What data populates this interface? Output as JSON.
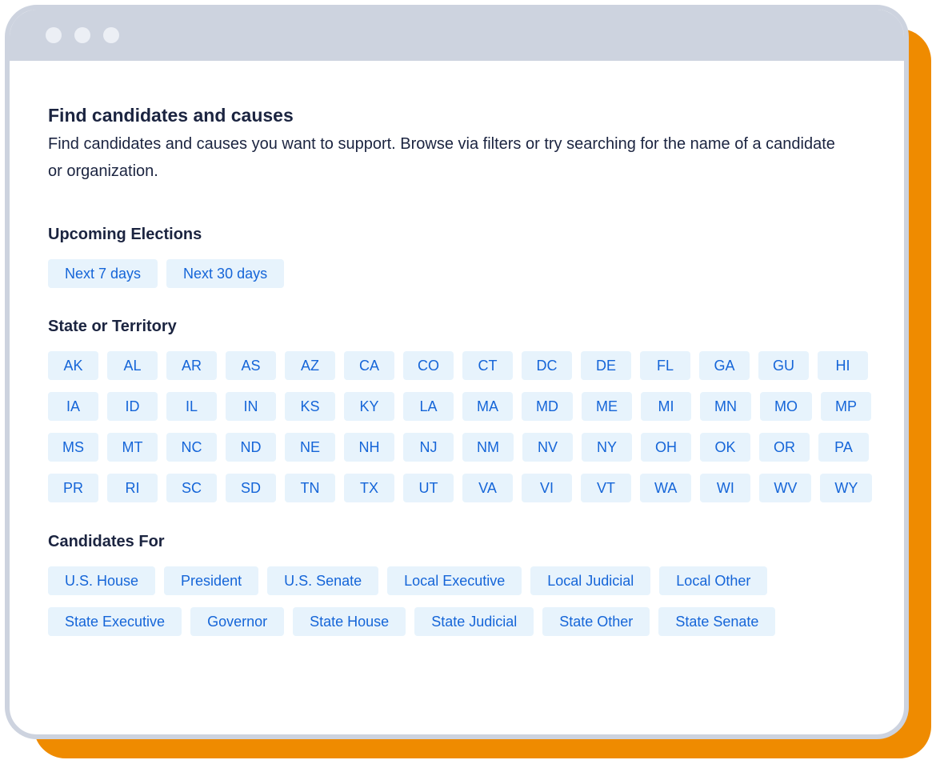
{
  "header": {
    "title": "Find candidates and causes",
    "description": "Find candidates and causes you want to support. Browse via filters or try searching for the name of a candidate or organization."
  },
  "upcoming_elections": {
    "title": "Upcoming Elections",
    "options": [
      "Next 7 days",
      "Next 30 days"
    ]
  },
  "states": {
    "title": "State or Territory",
    "options": [
      "AK",
      "AL",
      "AR",
      "AS",
      "AZ",
      "CA",
      "CO",
      "CT",
      "DC",
      "DE",
      "FL",
      "GA",
      "GU",
      "HI",
      "IA",
      "ID",
      "IL",
      "IN",
      "KS",
      "KY",
      "LA",
      "MA",
      "MD",
      "ME",
      "MI",
      "MN",
      "MO",
      "MP",
      "MS",
      "MT",
      "NC",
      "ND",
      "NE",
      "NH",
      "NJ",
      "NM",
      "NV",
      "NY",
      "OH",
      "OK",
      "OR",
      "PA",
      "PR",
      "RI",
      "SC",
      "SD",
      "TN",
      "TX",
      "UT",
      "VA",
      "VI",
      "VT",
      "WA",
      "WI",
      "WV",
      "WY"
    ]
  },
  "candidates_for": {
    "title": "Candidates For",
    "options": [
      "U.S. House",
      "President",
      "U.S. Senate",
      "Local Executive",
      "Local Judicial",
      "Local Other",
      "State Executive",
      "Governor",
      "State House",
      "State Judicial",
      "State Other",
      "State Senate"
    ]
  },
  "colors": {
    "accent": "#ef8b00",
    "chip_bg": "#e7f3fc",
    "chip_text": "#1565d8",
    "window_frame": "#cdd3df"
  }
}
